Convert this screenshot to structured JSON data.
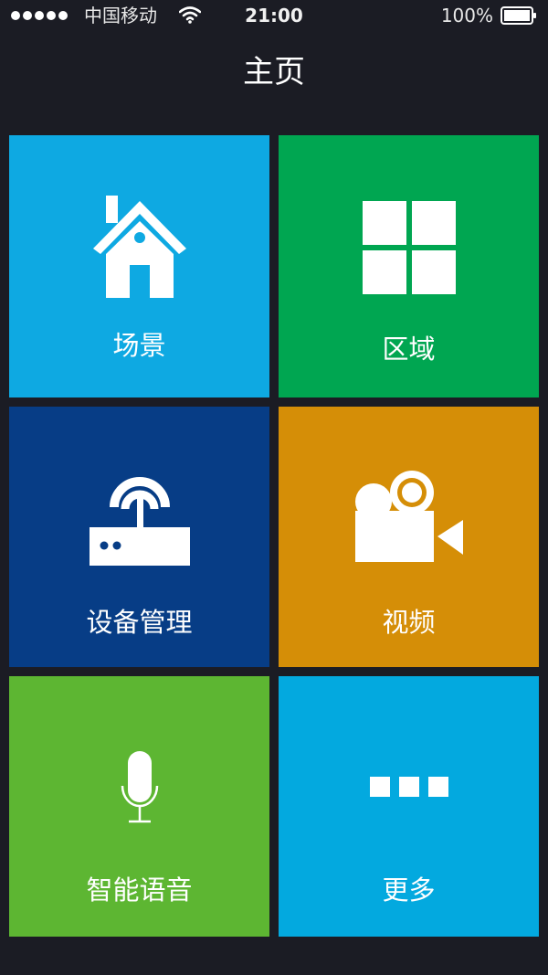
{
  "status_bar": {
    "carrier": "中国移动",
    "time": "21:00",
    "battery": "100%"
  },
  "header": {
    "title": "主页"
  },
  "tiles": [
    {
      "label": "场景",
      "color": "#0ea9e2",
      "icon": "house-icon"
    },
    {
      "label": "区域",
      "color": "#00a651",
      "icon": "grid-icon"
    },
    {
      "label": "设备管理",
      "color": "#073d86",
      "icon": "router-icon"
    },
    {
      "label": "视频",
      "color": "#d58e07",
      "icon": "video-camera-icon"
    },
    {
      "label": "智能语音",
      "color": "#5db632",
      "icon": "microphone-icon"
    },
    {
      "label": "更多",
      "color": "#03a9df",
      "icon": "more-icon"
    }
  ]
}
